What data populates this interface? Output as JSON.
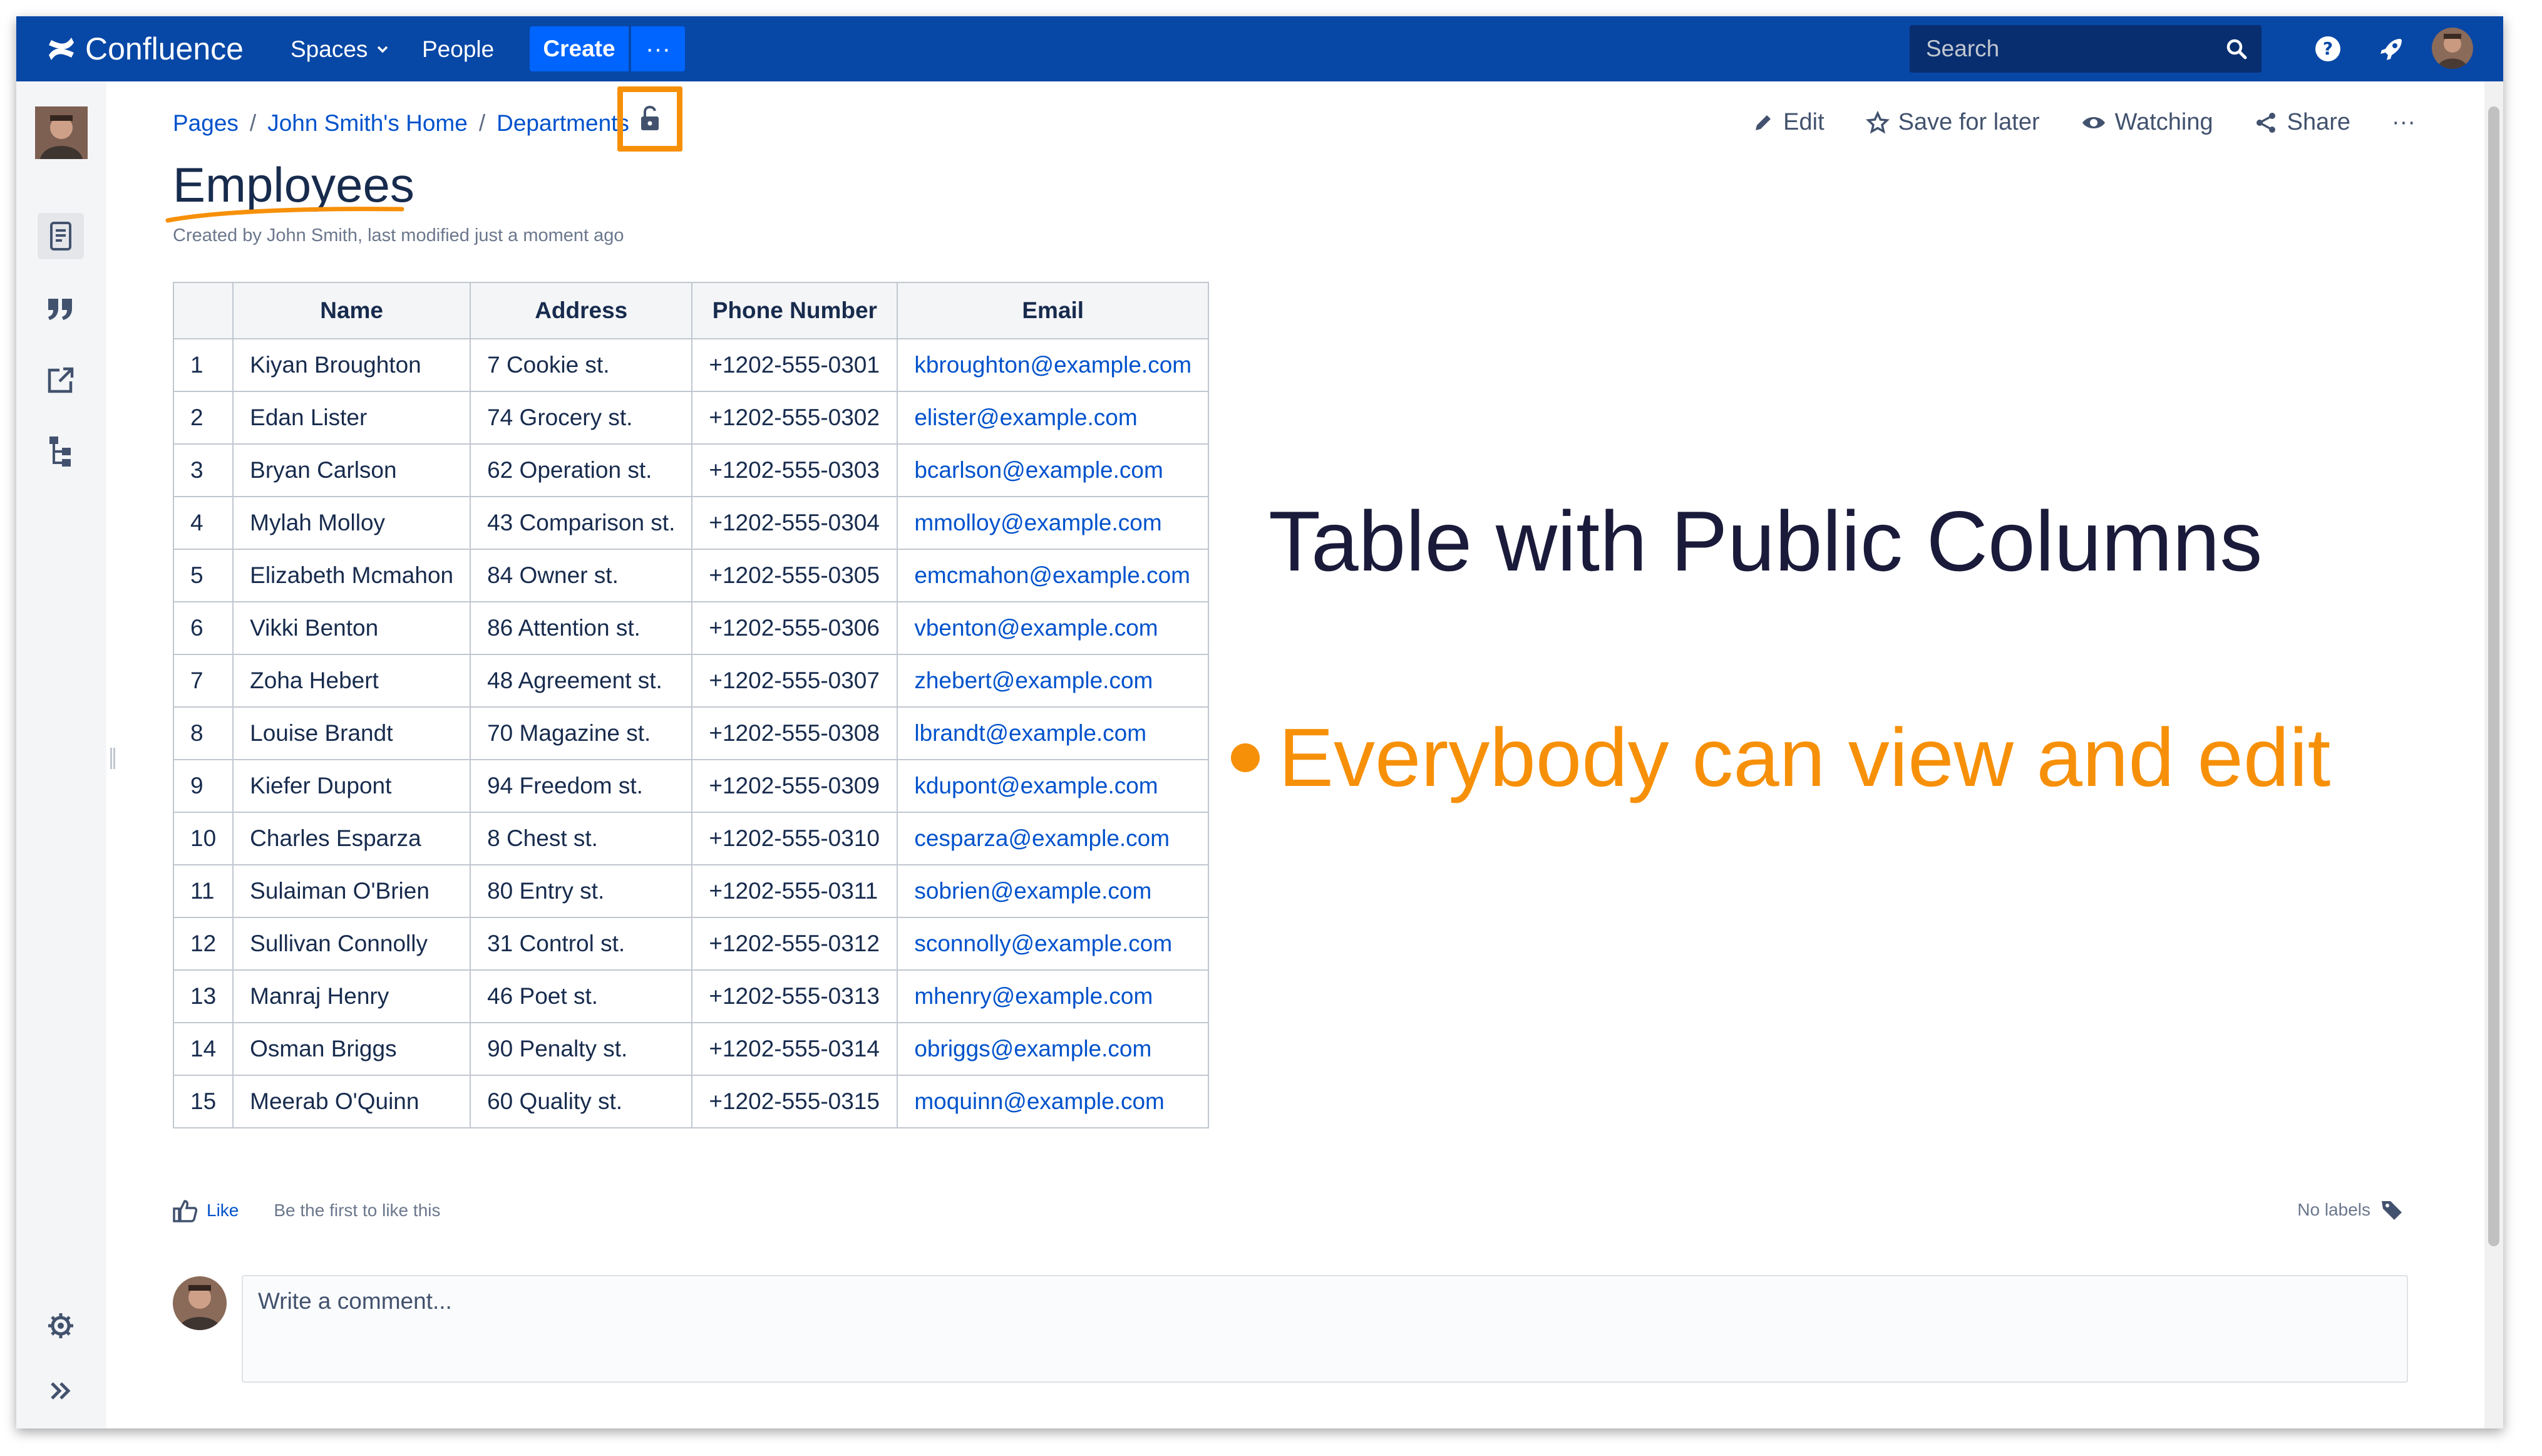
{
  "nav": {
    "app_name": "Confluence",
    "spaces_label": "Spaces",
    "people_label": "People",
    "create_label": "Create",
    "more_label": "···",
    "search_placeholder": "Search"
  },
  "breadcrumb": [
    "Pages",
    "John Smith's Home",
    "Departments"
  ],
  "page_actions": {
    "edit": "Edit",
    "save_for_later": "Save for later",
    "watching": "Watching",
    "share": "Share",
    "more": "···"
  },
  "page": {
    "title": "Employees",
    "byline": "Created by John Smith, last modified just a moment ago"
  },
  "table": {
    "headers": [
      "",
      "Name",
      "Address",
      "Phone Number",
      "Email"
    ],
    "rows": [
      [
        "1",
        "Kiyan Broughton",
        "7 Cookie st.",
        "+1202-555-0301",
        "kbroughton@example.com"
      ],
      [
        "2",
        "Edan Lister",
        "74 Grocery st.",
        "+1202-555-0302",
        "elister@example.com"
      ],
      [
        "3",
        "Bryan Carlson",
        "62 Operation st.",
        "+1202-555-0303",
        "bcarlson@example.com"
      ],
      [
        "4",
        "Mylah Molloy",
        "43 Comparison st.",
        "+1202-555-0304",
        "mmolloy@example.com"
      ],
      [
        "5",
        "Elizabeth Mcmahon",
        "84 Owner st.",
        "+1202-555-0305",
        "emcmahon@example.com"
      ],
      [
        "6",
        "Vikki Benton",
        "86 Attention st.",
        "+1202-555-0306",
        "vbenton@example.com"
      ],
      [
        "7",
        "Zoha Hebert",
        "48 Agreement st.",
        "+1202-555-0307",
        "zhebert@example.com"
      ],
      [
        "8",
        "Louise Brandt",
        "70 Magazine st.",
        "+1202-555-0308",
        "lbrandt@example.com"
      ],
      [
        "9",
        "Kiefer Dupont",
        "94 Freedom st.",
        "+1202-555-0309",
        "kdupont@example.com"
      ],
      [
        "10",
        "Charles Esparza",
        "8 Chest st.",
        "+1202-555-0310",
        "cesparza@example.com"
      ],
      [
        "11",
        "Sulaiman O'Brien",
        "80 Entry st.",
        "+1202-555-0311",
        "sobrien@example.com"
      ],
      [
        "12",
        "Sullivan Connolly",
        "31 Control st.",
        "+1202-555-0312",
        "sconnolly@example.com"
      ],
      [
        "13",
        "Manraj Henry",
        "46 Poet st.",
        "+1202-555-0313",
        "mhenry@example.com"
      ],
      [
        "14",
        "Osman Briggs",
        "90 Penalty st.",
        "+1202-555-0314",
        "obriggs@example.com"
      ],
      [
        "15",
        "Meerab O'Quinn",
        "60 Quality st.",
        "+1202-555-0315",
        "moquinn@example.com"
      ]
    ]
  },
  "annotation": {
    "title": "Table with Public Columns",
    "bullet": "Everybody can view and edit"
  },
  "footer": {
    "like_label": "Like",
    "like_hint": "Be the first to like this",
    "labels_text": "No labels",
    "comment_placeholder": "Write a comment..."
  },
  "colors": {
    "nav_bg": "#0747a6",
    "create_bg": "#0065ff",
    "link": "#0052cc",
    "highlight": "#f79009"
  },
  "icons": {
    "sidebar": [
      "avatar",
      "page-icon",
      "quote-icon",
      "external-link-icon",
      "tree-icon",
      "gear-icon",
      "expand-icon"
    ],
    "top": [
      "search-icon",
      "help-icon",
      "notifications-icon",
      "avatar"
    ]
  }
}
